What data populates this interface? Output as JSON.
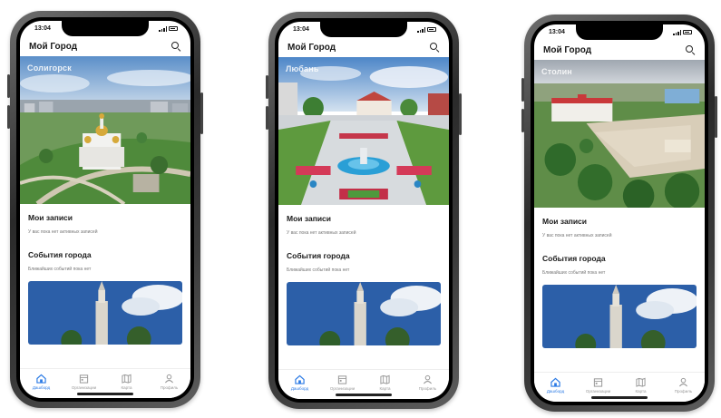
{
  "colors": {
    "accent": "#2c7be5",
    "inactive": "#999999",
    "title": "#1a1a1a"
  },
  "phones": [
    {
      "time": "13:04",
      "app_title": "Мой Город",
      "city": "Солигорск",
      "sections": [
        {
          "title": "Мои записи",
          "subtitle": "У вас пока нет активных записей"
        },
        {
          "title": "События города",
          "subtitle": "Ближайших событий пока нет"
        }
      ],
      "tabs": [
        {
          "label": "Дашборд",
          "icon": "home-icon",
          "active": true
        },
        {
          "label": "Организации",
          "icon": "building-icon",
          "active": false
        },
        {
          "label": "Карта",
          "icon": "map-icon",
          "active": false
        },
        {
          "label": "Профиль",
          "icon": "user-icon",
          "active": false
        }
      ]
    },
    {
      "time": "13:04",
      "app_title": "Мой Город",
      "city": "Любань",
      "sections": [
        {
          "title": "Мои записи",
          "subtitle": "У вас пока нет активных записей"
        },
        {
          "title": "События города",
          "subtitle": "Ближайших событий пока нет"
        }
      ],
      "tabs": [
        {
          "label": "Дашборд",
          "icon": "home-icon",
          "active": true
        },
        {
          "label": "Организации",
          "icon": "building-icon",
          "active": false
        },
        {
          "label": "Карта",
          "icon": "map-icon",
          "active": false
        },
        {
          "label": "Профиль",
          "icon": "user-icon",
          "active": false
        }
      ]
    },
    {
      "time": "13:04",
      "app_title": "Мой Город",
      "city": "Столин",
      "sections": [
        {
          "title": "Мои записи",
          "subtitle": "У вас пока нет активных записей"
        },
        {
          "title": "События города",
          "subtitle": "Ближайших событий пока нет"
        }
      ],
      "tabs": [
        {
          "label": "Дашборд",
          "icon": "home-icon",
          "active": true
        },
        {
          "label": "Организации",
          "icon": "building-icon",
          "active": false
        },
        {
          "label": "Карта",
          "icon": "map-icon",
          "active": false
        },
        {
          "label": "Профиль",
          "icon": "user-icon",
          "active": false
        }
      ]
    }
  ]
}
